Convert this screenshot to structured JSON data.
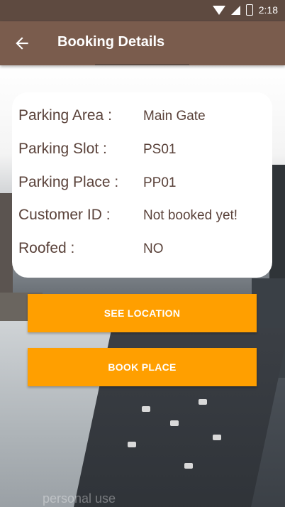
{
  "status_bar": {
    "time": "2:18"
  },
  "app_bar": {
    "title": "Booking Details"
  },
  "details": [
    {
      "label": "Parking Area :",
      "value": "Main Gate"
    },
    {
      "label": "Parking Slot :",
      "value": "PS01"
    },
    {
      "label": "Parking Place :",
      "value": "PP01"
    },
    {
      "label": "Customer ID :",
      "value": "Not booked yet!"
    },
    {
      "label": "Roofed :",
      "value": "NO"
    }
  ],
  "buttons": {
    "see_location": "SEE LOCATION",
    "book_place": "BOOK PLACE"
  },
  "watermark": "personal use",
  "colors": {
    "app_bar": "#7a5c4d",
    "status_bar": "#5e4a40",
    "button": "#ff9f00",
    "text": "#5a423a"
  }
}
